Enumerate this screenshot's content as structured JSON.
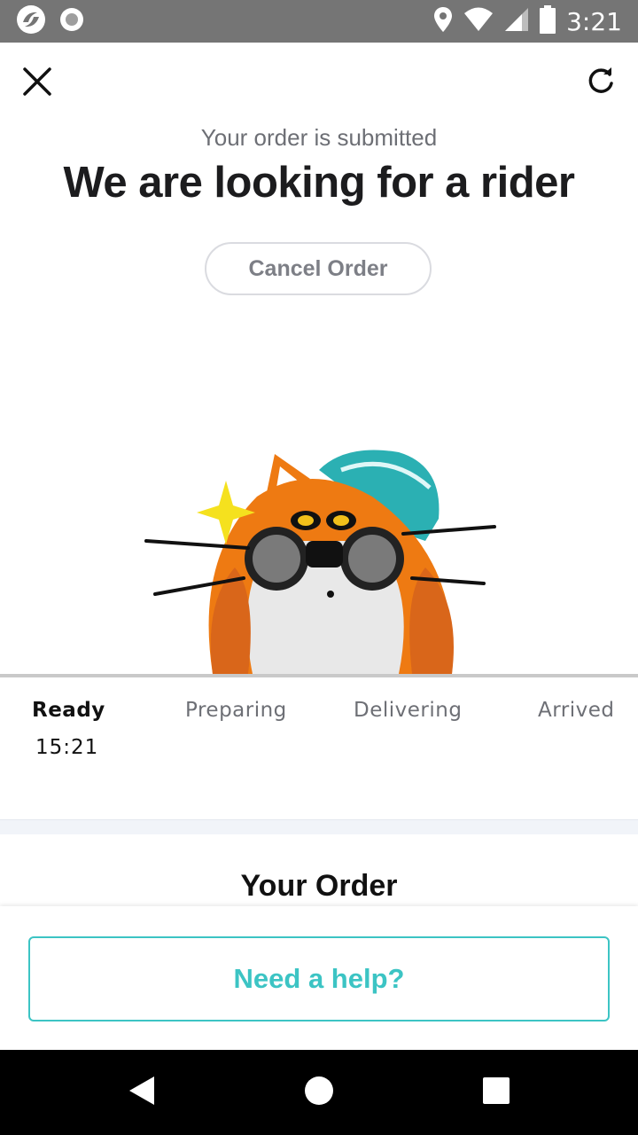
{
  "status_bar": {
    "time": "3:21",
    "icons": [
      "app-logo-icon",
      "record-icon",
      "location-icon",
      "wifi-icon",
      "signal-icon",
      "battery-icon"
    ]
  },
  "top_bar": {
    "close_icon": "close-icon",
    "refresh_icon": "refresh-icon"
  },
  "header": {
    "subtitle": "Your order is submitted",
    "title": "We are looking for a rider",
    "cancel_label": "Cancel Order"
  },
  "progress": {
    "steps": [
      {
        "label": "Ready",
        "time": "15:21",
        "active": true
      },
      {
        "label": "Preparing",
        "active": false
      },
      {
        "label": "Delivering",
        "active": false
      },
      {
        "label": "Arrived",
        "active": false
      }
    ]
  },
  "order": {
    "heading": "Your Order"
  },
  "actions": {
    "help_label": "Need a help?"
  },
  "colors": {
    "accent": "#3cc4c4",
    "status_bar": "#757575",
    "title": "#1c1c1e",
    "muted": "#6d6f75"
  },
  "nav_bar": {
    "icons": [
      "back-icon",
      "home-icon",
      "recents-icon"
    ]
  }
}
